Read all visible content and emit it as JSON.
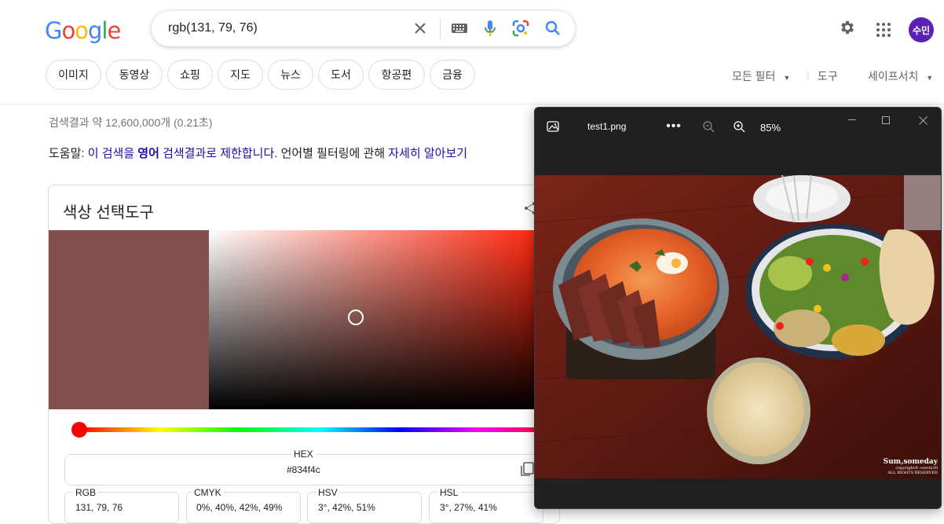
{
  "header": {
    "logo": "Google",
    "query": "rgb(131, 79, 76)",
    "avatar_text": "수민"
  },
  "chips": [
    "이미지",
    "동영상",
    "쇼핑",
    "지도",
    "뉴스",
    "도서",
    "항공편",
    "금융"
  ],
  "right_links": {
    "all_filters": "모든 필터",
    "tools": "도구",
    "safesearch": "세이프서치"
  },
  "results": {
    "stats": "검색결과 약 12,600,000개 (0.21초)",
    "help_prefix": "도움말: ",
    "help_link1a": "이 검색을 ",
    "help_link1b": "영어",
    "help_link1c": " 검색결과로 제한합니다",
    "help_mid": ". 언어별 필터링에 관해 ",
    "help_link2": "자세히 알아보기"
  },
  "color_picker": {
    "title": "색상 선택도구",
    "swatch_color": "#834f4c",
    "hex_label": "HEX",
    "hex_value": "#834f4c",
    "fields": [
      {
        "label": "RGB",
        "value": "131, 79, 76"
      },
      {
        "label": "CMYK",
        "value": "0%, 40%, 42%, 49%"
      },
      {
        "label": "HSV",
        "value": "3°, 42%, 51%"
      },
      {
        "label": "HSL",
        "value": "3°, 27%, 41%"
      }
    ]
  },
  "viewer": {
    "filename": "test1.png",
    "zoom": "85%",
    "watermark_title": "Sum,someday",
    "watermark_line1": "copyright© coevin30",
    "watermark_line2": "ALL RIGHTS RESERVED"
  }
}
